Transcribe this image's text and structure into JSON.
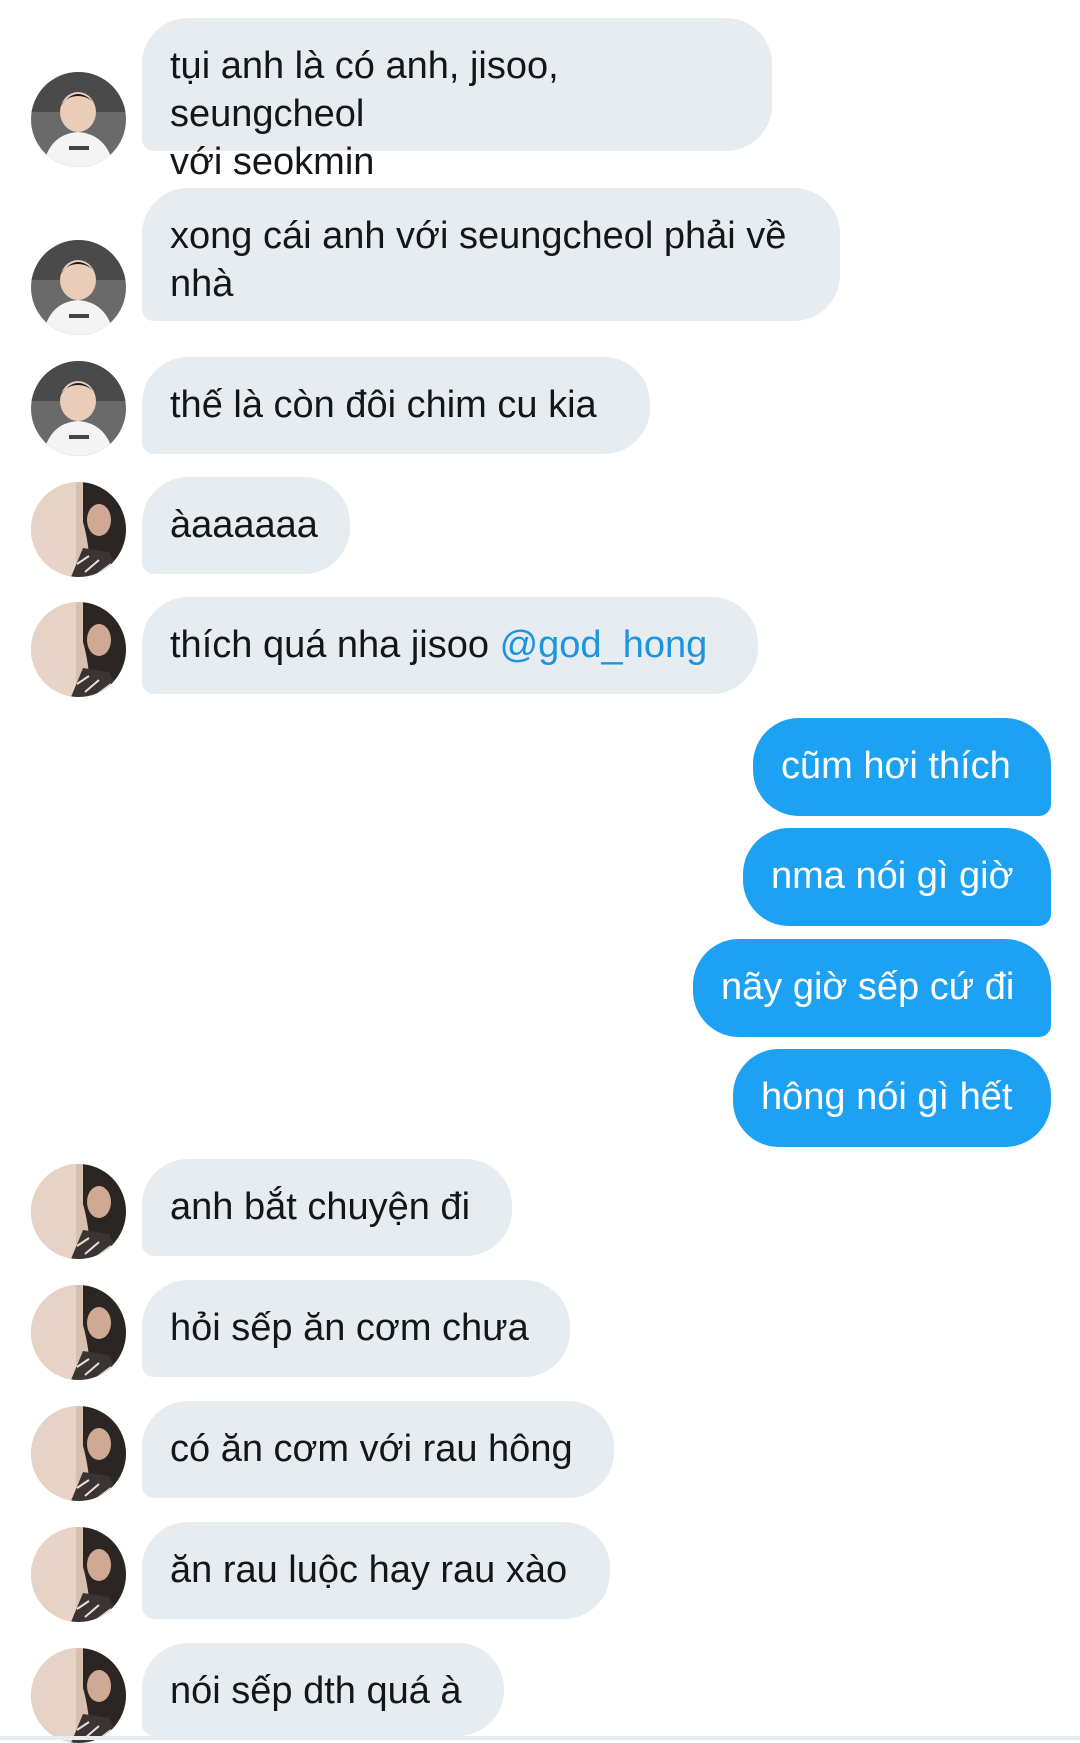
{
  "conversation": {
    "messages": [
      {
        "sender": "other",
        "avatar": "avatar-a",
        "text": "tụi anh là có anh, jisoo, seungcheol\nvới seokmin"
      },
      {
        "sender": "other",
        "avatar": "avatar-a",
        "text": "xong cái anh với seungcheol phải về\nnhà"
      },
      {
        "sender": "other",
        "avatar": "avatar-a",
        "text": "thế là còn đôi chim cu kia"
      },
      {
        "sender": "other",
        "avatar": "avatar-b",
        "text": "àaaaaaa"
      },
      {
        "sender": "other",
        "avatar": "avatar-b",
        "text": "thích quá nha jisoo ",
        "mention": "@god_hong"
      },
      {
        "sender": "me",
        "text": "cũm hơi thích"
      },
      {
        "sender": "me",
        "text": "nma nói gì giờ"
      },
      {
        "sender": "me",
        "text": "nãy giờ sếp cứ đi"
      },
      {
        "sender": "me",
        "text": "hông nói gì hết"
      },
      {
        "sender": "other",
        "avatar": "avatar-b",
        "text": "anh bắt chuyện đi"
      },
      {
        "sender": "other",
        "avatar": "avatar-b",
        "text": "hỏi sếp ăn cơm chưa"
      },
      {
        "sender": "other",
        "avatar": "avatar-b",
        "text": "có ăn cơm với rau hông"
      },
      {
        "sender": "other",
        "avatar": "avatar-b",
        "text": "ăn rau luộc hay rau xào"
      },
      {
        "sender": "other",
        "avatar": "avatar-b",
        "text": "nói sếp dth quá à"
      }
    ]
  },
  "colors": {
    "incoming_bubble": "#e6ecf0",
    "outgoing_bubble": "#1da1f2",
    "mention": "#1b95e0",
    "text": "#14171a"
  }
}
